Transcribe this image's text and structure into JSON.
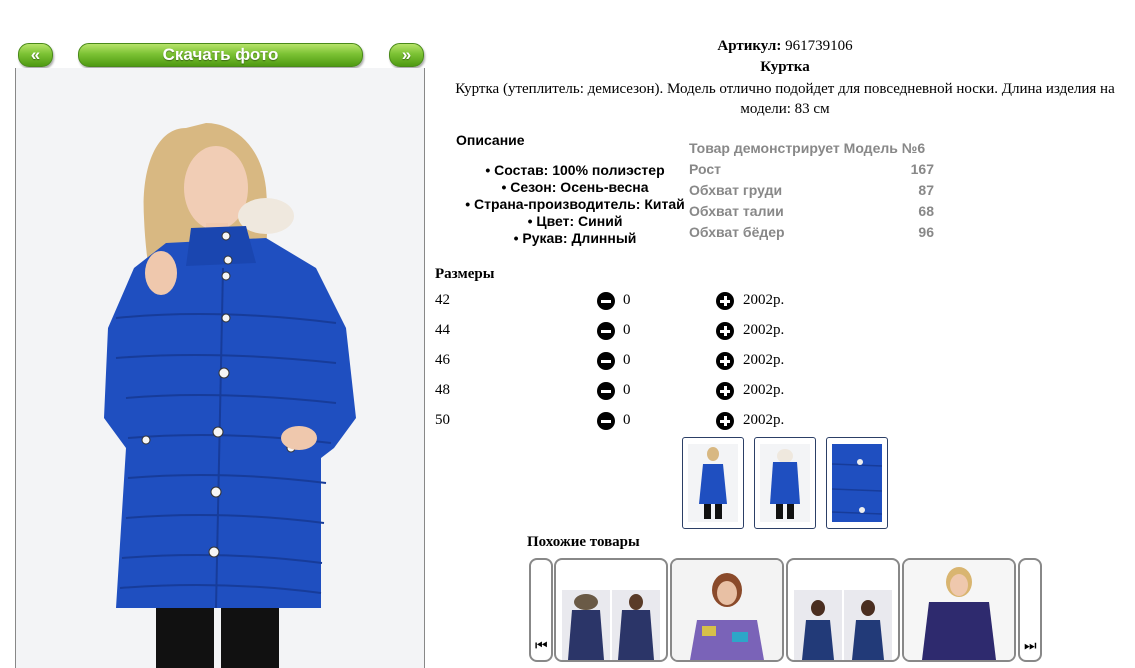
{
  "nav": {
    "prev_label": "«",
    "download_label": "Скачать фото",
    "next_label": "»"
  },
  "product": {
    "sku_label": "Артикул:",
    "sku": "961739106",
    "title": "Куртка",
    "description": "Куртка (утеплитель: демисезон). Модель отлично подойдет для повседневной носки. Длина изделия на модели: 83 см"
  },
  "specs": {
    "heading": "Описание",
    "items": [
      "Состав: 100% полиэстер",
      "Сезон: Осень-весна",
      "Страна-производитель: Китай",
      "Цвет: Синий",
      "Рукав: Длинный"
    ]
  },
  "model": {
    "heading": "Товар демонстрирует Модель №6",
    "rows": [
      {
        "label": "Рост",
        "value": "167"
      },
      {
        "label": "Обхват груди",
        "value": "87"
      },
      {
        "label": "Обхват талии",
        "value": "68"
      },
      {
        "label": "Обхват бёдер",
        "value": "96"
      }
    ]
  },
  "sizes": {
    "heading": "Размеры",
    "rows": [
      {
        "size": "42",
        "qty": "0",
        "price": "2002р."
      },
      {
        "size": "44",
        "qty": "0",
        "price": "2002р."
      },
      {
        "size": "46",
        "qty": "0",
        "price": "2002р."
      },
      {
        "size": "48",
        "qty": "0",
        "price": "2002р."
      },
      {
        "size": "50",
        "qty": "0",
        "price": "2002р."
      }
    ]
  },
  "similar": {
    "heading": "Похожие товары",
    "prev_icon": "⏮",
    "next_icon": "⏭"
  },
  "colors": {
    "jacket_blue": "#1f4fc0",
    "button_green": "#6db62a"
  }
}
